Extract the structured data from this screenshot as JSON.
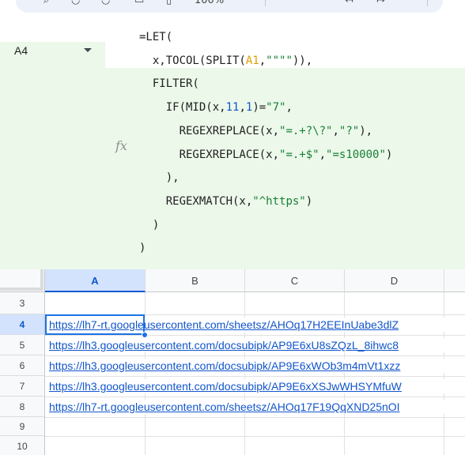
{
  "toolbar": {
    "icons": [
      "search-icon",
      "bold-icon",
      "paint-format-icon",
      "print-icon",
      "format-icon",
      "zoom-value",
      "undo-icon",
      "redo-icon"
    ],
    "zoom_label": "100%"
  },
  "namebox": {
    "value": "A4"
  },
  "formula": {
    "fx_label": "fx",
    "lines": [
      [
        "=LET("
      ],
      [
        "  x,TOCOL(SPLIT(",
        "A1",
        ",",
        "\"\"\"\"",
        ")),"
      ],
      [
        "  FILTER("
      ],
      [
        "    IF(MID(x,",
        "11",
        ",",
        "1",
        ")=",
        "\"7\"",
        ","
      ],
      [
        "      REGEXREPLACE(x,",
        "\"=.+?\\?\"",
        ",",
        "\"?\"",
        "),"
      ],
      [
        "      REGEXREPLACE(x,",
        "\"=.+$\"",
        ",",
        "\"=s10000\"",
        ")"
      ],
      [
        "    ),"
      ],
      [
        "    REGEXMATCH(x,",
        "\"^https\"",
        ")"
      ],
      [
        "  )"
      ],
      [
        ")"
      ]
    ]
  },
  "grid": {
    "columns": [
      "A",
      "B",
      "C",
      "D"
    ],
    "active_column": "A",
    "rows": [
      "3",
      "4",
      "5",
      "6",
      "7",
      "8",
      "9",
      "10"
    ],
    "active_row": "4",
    "cells": [
      "",
      "https://lh7-rt.googleusercontent.com/sheetsz/AHOq17H2EEInUabe3dlZ",
      "https://lh3.googleusercontent.com/docsubipk/AP9E6xU8sZQzL_8ihwc8",
      "https://lh3.googleusercontent.com/docsubipk/AP9E6xWOb3m4mVt1xzz",
      "https://lh3.googleusercontent.com/docsubipk/AP9E6xXSJwWHSYMfuW",
      "https://lh7-rt.googleusercontent.com/sheetsz/AHOq17F19QqXND25nOI",
      "",
      ""
    ]
  },
  "colors": {
    "formula_bg": "#ecf8ea",
    "ref": "#e0a000",
    "number": "#1155cc",
    "string": "#188038",
    "selection": "#1a73e8",
    "link": "#1155cc"
  }
}
